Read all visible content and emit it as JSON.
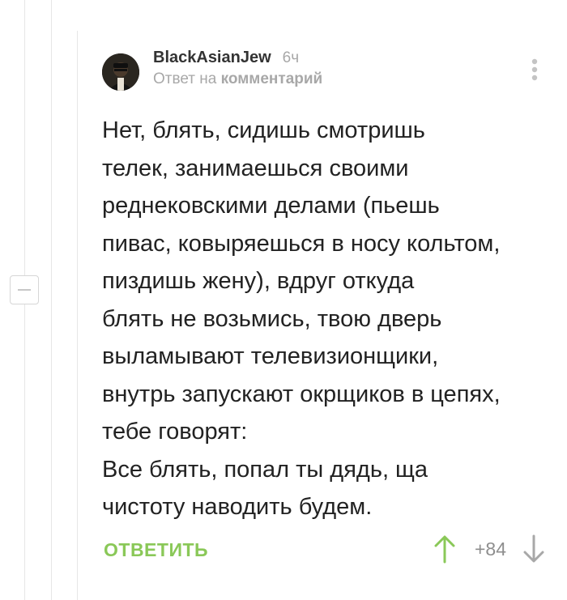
{
  "comment": {
    "author": "BlackAsianJew",
    "time": "6ч",
    "reply_prefix": "Ответ на",
    "reply_link": "комментарий",
    "body_lines": [
      "Нет, блять, сидишь смотришь",
      "телек, занимаешься своими",
      "реднековскими делами (пьешь",
      "пивас, ковыряешься в носу кольтом,",
      "пиздишь жену), вдруг откуда",
      "блять не возьмись, твою дверь",
      "выламывают телевизионщики,",
      "внутрь запускают окрщиков в цепях,",
      "тебе говорят:",
      "Все блять, попал ты дядь, ща",
      "чистоту наводить будем."
    ],
    "reply_button": "ОТВЕТИТЬ",
    "rating": "+84"
  },
  "colors": {
    "accent_green": "#8ac858",
    "muted": "#a8a8a8",
    "text": "#222222"
  },
  "icons": {
    "more": "more-vertical-icon",
    "upvote": "arrow-up-icon",
    "downvote": "arrow-down-icon",
    "collapse": "minus-icon"
  }
}
